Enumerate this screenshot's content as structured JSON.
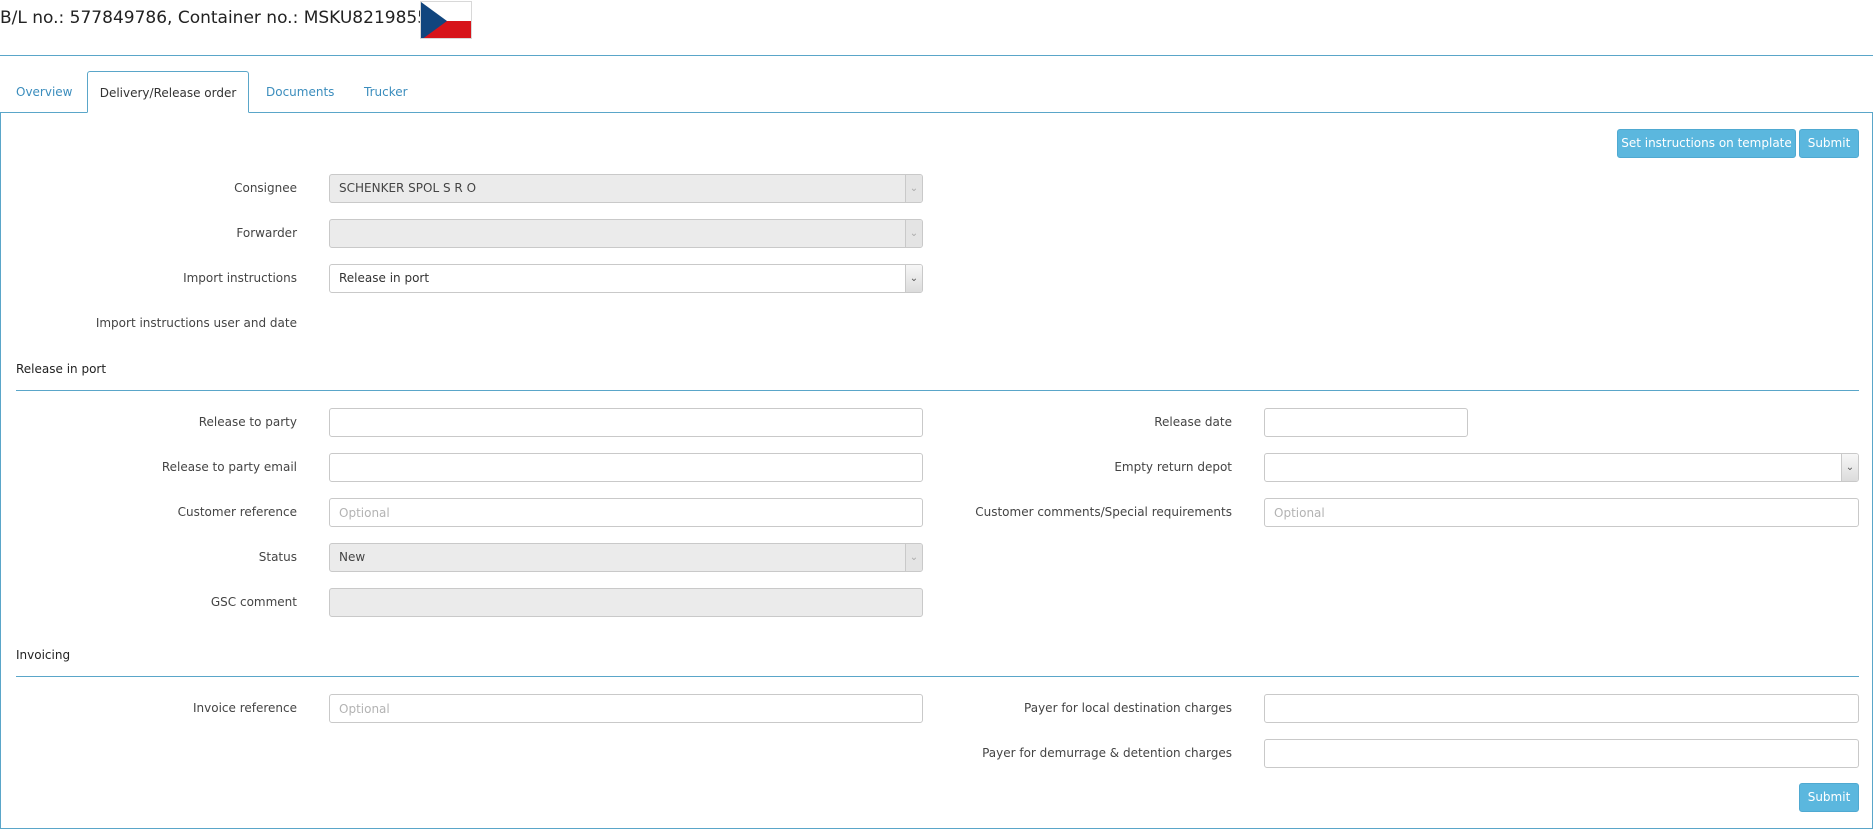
{
  "header": {
    "title": "B/L no.: 577849786, Container no.: MSKU8219855",
    "flag_icon": "czech-flag-icon"
  },
  "tabs": [
    {
      "label": "Overview",
      "active": false
    },
    {
      "label": "Delivery/Release order",
      "active": true
    },
    {
      "label": "Documents",
      "active": false
    },
    {
      "label": "Trucker",
      "active": false
    }
  ],
  "actions": {
    "set_template_label": "Set instructions on template",
    "submit_label": "Submit"
  },
  "form": {
    "consignee": {
      "label": "Consignee",
      "value": "SCHENKER SPOL S R O"
    },
    "forwarder": {
      "label": "Forwarder",
      "value": ""
    },
    "import_instructions": {
      "label": "Import instructions",
      "value": "Release in port"
    },
    "import_user_date": {
      "label": "Import instructions user and date",
      "value": ""
    }
  },
  "release": {
    "title": "Release in port",
    "party": {
      "label": "Release to party",
      "value": ""
    },
    "party_email": {
      "label": "Release to party email",
      "value": ""
    },
    "customer_reference": {
      "label": "Customer reference",
      "placeholder": "Optional"
    },
    "status": {
      "label": "Status",
      "value": "New"
    },
    "gsc_comment": {
      "label": "GSC comment",
      "value": ""
    },
    "release_date": {
      "label": "Release date",
      "value": ""
    },
    "empty_return_depot": {
      "label": "Empty return depot",
      "value": ""
    },
    "customer_comments": {
      "label": "Customer comments/Special requirements",
      "placeholder": "Optional"
    }
  },
  "invoicing": {
    "title": "Invoicing",
    "invoice_reference": {
      "label": "Invoice reference",
      "placeholder": "Optional"
    },
    "payer_local": {
      "label": "Payer for local destination charges",
      "value": ""
    },
    "payer_demurrage": {
      "label": "Payer for demurrage & detention charges",
      "value": ""
    }
  },
  "colors": {
    "accent": "#5aa6c9",
    "button": "#5bb7de",
    "link": "#3b8dbd"
  }
}
